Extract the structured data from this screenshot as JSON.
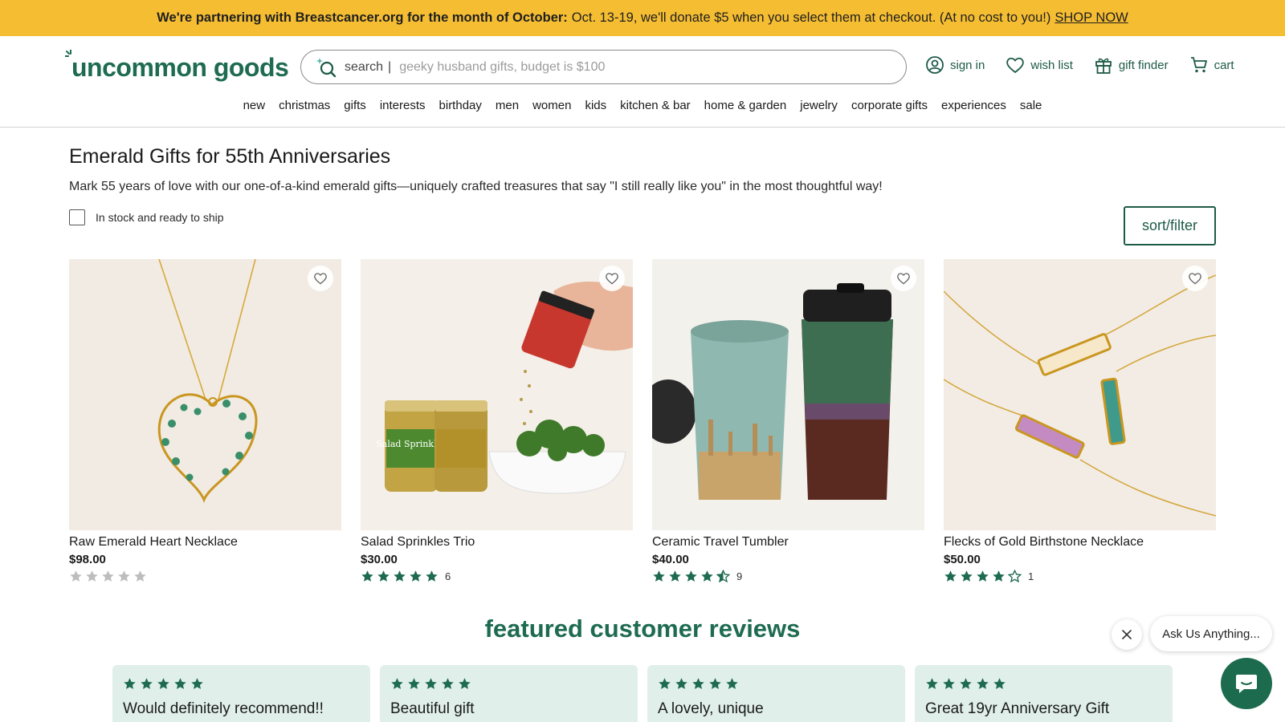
{
  "promo": {
    "bold": "We're partnering with Breastcancer.org for the month of October:",
    "text": "Oct. 13-19, we'll donate $5 when you select them at checkout. (At no cost to you!)",
    "link": "SHOP NOW"
  },
  "header": {
    "logo": "uncommon goods",
    "search": {
      "label": "search",
      "divider": "|",
      "placeholder": "geeky husband gifts, budget is $100"
    },
    "utils": {
      "sign_in": "sign in",
      "wish_list": "wish list",
      "gift_finder": "gift finder",
      "cart": "cart"
    },
    "nav": [
      "new",
      "christmas",
      "gifts",
      "interests",
      "birthday",
      "men",
      "women",
      "kids",
      "kitchen & bar",
      "home & garden",
      "jewelry",
      "corporate gifts",
      "experiences",
      "sale"
    ]
  },
  "page": {
    "title": "Emerald Gifts for 55th Anniversaries",
    "description": "Mark 55 years of love with our one-of-a-kind emerald gifts—uniquely crafted treasures that say \"I still really like you\" in the most thoughtful way!",
    "stock_filter": "In stock and ready to ship",
    "sort_filter": "sort/filter"
  },
  "products": [
    {
      "name": "Raw Emerald Heart Necklace",
      "price": "$98.00",
      "rating": 0,
      "review_count": ""
    },
    {
      "name": "Salad Sprinkles Trio",
      "price": "$30.00",
      "rating": 5,
      "review_count": "6"
    },
    {
      "name": "Ceramic Travel Tumbler",
      "price": "$40.00",
      "rating": 4.5,
      "review_count": "9"
    },
    {
      "name": "Flecks of Gold Birthstone Necklace",
      "price": "$50.00",
      "rating": 4,
      "review_count": "1"
    }
  ],
  "product_image_text": {
    "salad_jar": "Salad Sprinkles"
  },
  "reviews": {
    "heading": "featured customer reviews",
    "items": [
      {
        "rating": 5,
        "title": "Would definitely recommend!!"
      },
      {
        "rating": 5,
        "title": "Beautiful gift"
      },
      {
        "rating": 5,
        "title": "A lovely, unique"
      },
      {
        "rating": 5,
        "title": "Great 19yr Anniversary Gift"
      }
    ]
  },
  "chat": {
    "prompt": "Ask Us Anything..."
  },
  "colors": {
    "brand_green": "#1e6b52",
    "promo_yellow": "#f5bd32",
    "star_green": "#1e6b52",
    "review_card": "#e0efea"
  }
}
